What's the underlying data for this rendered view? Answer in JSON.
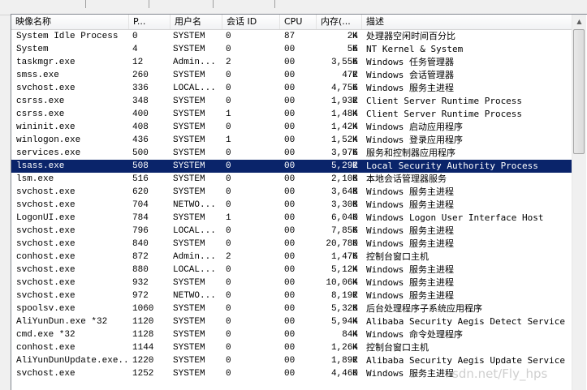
{
  "columns": {
    "name": "映像名称",
    "pid": "P...",
    "user": "用户名",
    "session": "会话 ID",
    "cpu": "CPU",
    "memory": "内存(...",
    "description": "描述"
  },
  "mem_unit": "K",
  "processes": [
    {
      "name": "System Idle Process",
      "pid": "0",
      "user": "SYSTEM",
      "session": "0",
      "cpu": "87",
      "mem": "24",
      "desc": "处理器空闲时间百分比"
    },
    {
      "name": "System",
      "pid": "4",
      "user": "SYSTEM",
      "session": "0",
      "cpu": "00",
      "mem": "56",
      "desc": "NT Kernel & System"
    },
    {
      "name": "taskmgr.exe",
      "pid": "12",
      "user": "Admin...",
      "session": "2",
      "cpu": "00",
      "mem": "3,556",
      "desc": "Windows 任务管理器"
    },
    {
      "name": "smss.exe",
      "pid": "260",
      "user": "SYSTEM",
      "session": "0",
      "cpu": "00",
      "mem": "472",
      "desc": "Windows 会话管理器"
    },
    {
      "name": "svchost.exe",
      "pid": "336",
      "user": "LOCAL...",
      "session": "0",
      "cpu": "00",
      "mem": "4,756",
      "desc": "Windows 服务主进程"
    },
    {
      "name": "csrss.exe",
      "pid": "348",
      "user": "SYSTEM",
      "session": "0",
      "cpu": "00",
      "mem": "1,932",
      "desc": "Client Server Runtime Process"
    },
    {
      "name": "csrss.exe",
      "pid": "400",
      "user": "SYSTEM",
      "session": "1",
      "cpu": "00",
      "mem": "1,484",
      "desc": "Client Server Runtime Process"
    },
    {
      "name": "wininit.exe",
      "pid": "408",
      "user": "SYSTEM",
      "session": "0",
      "cpu": "00",
      "mem": "1,424",
      "desc": "Windows 启动应用程序"
    },
    {
      "name": "winlogon.exe",
      "pid": "436",
      "user": "SYSTEM",
      "session": "1",
      "cpu": "00",
      "mem": "1,524",
      "desc": "Windows 登录应用程序"
    },
    {
      "name": "services.exe",
      "pid": "500",
      "user": "SYSTEM",
      "session": "0",
      "cpu": "00",
      "mem": "3,976",
      "desc": "服务和控制器应用程序"
    },
    {
      "name": "lsass.exe",
      "pid": "508",
      "user": "SYSTEM",
      "session": "0",
      "cpu": "00",
      "mem": "5,292",
      "desc": "Local Security Authority Process",
      "selected": true
    },
    {
      "name": "lsm.exe",
      "pid": "516",
      "user": "SYSTEM",
      "session": "0",
      "cpu": "00",
      "mem": "2,108",
      "desc": "本地会话管理器服务"
    },
    {
      "name": "svchost.exe",
      "pid": "620",
      "user": "SYSTEM",
      "session": "0",
      "cpu": "00",
      "mem": "3,648",
      "desc": "Windows 服务主进程"
    },
    {
      "name": "svchost.exe",
      "pid": "704",
      "user": "NETWO...",
      "session": "0",
      "cpu": "00",
      "mem": "3,308",
      "desc": "Windows 服务主进程"
    },
    {
      "name": "LogonUI.exe",
      "pid": "784",
      "user": "SYSTEM",
      "session": "1",
      "cpu": "00",
      "mem": "6,040",
      "desc": "Windows Logon User Interface Host"
    },
    {
      "name": "svchost.exe",
      "pid": "796",
      "user": "LOCAL...",
      "session": "0",
      "cpu": "00",
      "mem": "7,856",
      "desc": "Windows 服务主进程"
    },
    {
      "name": "svchost.exe",
      "pid": "840",
      "user": "SYSTEM",
      "session": "0",
      "cpu": "00",
      "mem": "20,780",
      "desc": "Windows 服务主进程"
    },
    {
      "name": "conhost.exe",
      "pid": "872",
      "user": "Admin...",
      "session": "2",
      "cpu": "00",
      "mem": "1,476",
      "desc": "控制台窗口主机"
    },
    {
      "name": "svchost.exe",
      "pid": "880",
      "user": "LOCAL...",
      "session": "0",
      "cpu": "00",
      "mem": "5,124",
      "desc": "Windows 服务主进程"
    },
    {
      "name": "svchost.exe",
      "pid": "932",
      "user": "SYSTEM",
      "session": "0",
      "cpu": "00",
      "mem": "10,064",
      "desc": "Windows 服务主进程"
    },
    {
      "name": "svchost.exe",
      "pid": "972",
      "user": "NETWO...",
      "session": "0",
      "cpu": "00",
      "mem": "8,192",
      "desc": "Windows 服务主进程"
    },
    {
      "name": "spoolsv.exe",
      "pid": "1060",
      "user": "SYSTEM",
      "session": "0",
      "cpu": "00",
      "mem": "5,328",
      "desc": "后台处理程序子系统应用程序"
    },
    {
      "name": "AliYunDun.exe *32",
      "pid": "1120",
      "user": "SYSTEM",
      "session": "0",
      "cpu": "00",
      "mem": "5,944",
      "desc": "Alibaba Security Aegis Detect Service"
    },
    {
      "name": "cmd.exe *32",
      "pid": "1128",
      "user": "SYSTEM",
      "session": "0",
      "cpu": "00",
      "mem": "844",
      "desc": "Windows 命令处理程序"
    },
    {
      "name": "conhost.exe",
      "pid": "1144",
      "user": "SYSTEM",
      "session": "0",
      "cpu": "00",
      "mem": "1,264",
      "desc": "控制台窗口主机"
    },
    {
      "name": "AliYunDunUpdate.exe...",
      "pid": "1220",
      "user": "SYSTEM",
      "session": "0",
      "cpu": "00",
      "mem": "1,892",
      "desc": "Alibaba Security Aegis Update Service"
    },
    {
      "name": "svchost.exe",
      "pid": "1252",
      "user": "SYSTEM",
      "session": "0",
      "cpu": "00",
      "mem": "4,460",
      "desc": "Windows 服务主进程"
    }
  ],
  "watermark": "sdn.net/Fly_hps",
  "colors": {
    "selection_bg": "#0a246a",
    "selection_fg": "#ffffff"
  },
  "icons": {
    "scroll_up": "scroll-up-arrow-icon"
  }
}
